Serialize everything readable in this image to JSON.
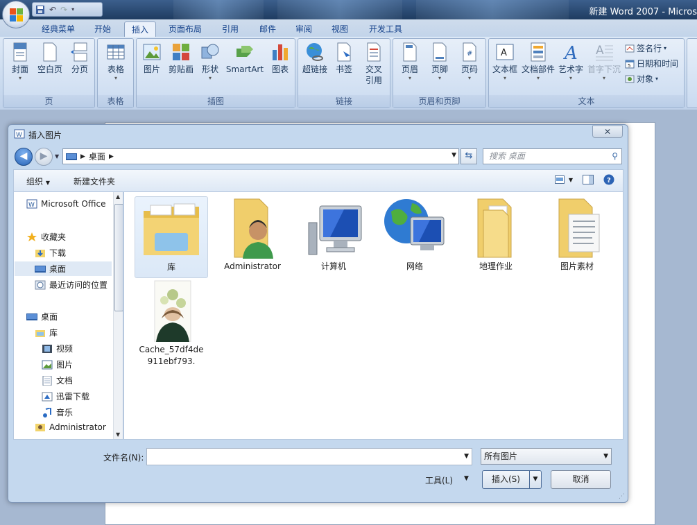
{
  "window": {
    "title": "新建 Word 2007 - Micros"
  },
  "quick_access": {
    "save_icon": "save-icon",
    "undo_icon": "undo-icon",
    "redo_icon": "redo-icon"
  },
  "ribbon": {
    "tabs": [
      {
        "label": "经典菜单"
      },
      {
        "label": "开始"
      },
      {
        "label": "插入"
      },
      {
        "label": "页面布局"
      },
      {
        "label": "引用"
      },
      {
        "label": "邮件"
      },
      {
        "label": "审阅"
      },
      {
        "label": "视图"
      },
      {
        "label": "开发工具"
      }
    ],
    "active_tab": "插入",
    "groups": {
      "pages": {
        "caption": "页",
        "buttons": [
          "封面",
          "空白页",
          "分页"
        ]
      },
      "table": {
        "caption": "表格",
        "buttons": [
          "表格"
        ]
      },
      "illustrations": {
        "caption": "插图",
        "buttons": [
          "图片",
          "剪贴画",
          "形状",
          "SmartArt",
          "图表"
        ]
      },
      "links": {
        "caption": "链接",
        "buttons": [
          "超链接",
          "书签",
          "交叉",
          "引用"
        ]
      },
      "header_footer": {
        "caption": "页眉和页脚",
        "buttons": [
          "页眉",
          "页脚",
          "页码"
        ]
      },
      "text": {
        "caption": "文本",
        "buttons": [
          "文本框",
          "文档部件",
          "艺术字",
          "首字下沉"
        ],
        "small": [
          "签名行",
          "日期和时间",
          "对象"
        ]
      }
    }
  },
  "dialog": {
    "title": "插入图片",
    "address": {
      "location": "桌面"
    },
    "search_placeholder": "搜索 桌面",
    "commands": {
      "organize": "组织",
      "new_folder": "新建文件夹"
    },
    "nav": {
      "office": "Microsoft Office",
      "favorites": "收藏夹",
      "downloads": "下载",
      "desktop_fav": "桌面",
      "recent": "最近访问的位置",
      "desktop": "桌面",
      "libraries": "库",
      "videos": "视频",
      "pictures": "图片",
      "documents": "文档",
      "thunder": "迅雷下载",
      "music": "音乐",
      "administrator": "Administrator"
    },
    "files": [
      {
        "name": "库"
      },
      {
        "name": "Administrator"
      },
      {
        "name": "计算机"
      },
      {
        "name": "网络"
      },
      {
        "name": "地理作业"
      },
      {
        "name": "图片素材"
      },
      {
        "name_line1": "Cache_57df4de",
        "name_line2": "911ebf793."
      }
    ],
    "filename_label": "文件名(N):",
    "filename_value": "",
    "filter_value": "所有图片",
    "tools_label": "工具(L)",
    "insert_label": "插入(S)",
    "cancel_label": "取消",
    "close_symbol": "✕"
  },
  "colors": {
    "ribbon_text": "#1e395b",
    "tab_text": "#15428b",
    "selection": "#dbe8f7"
  }
}
